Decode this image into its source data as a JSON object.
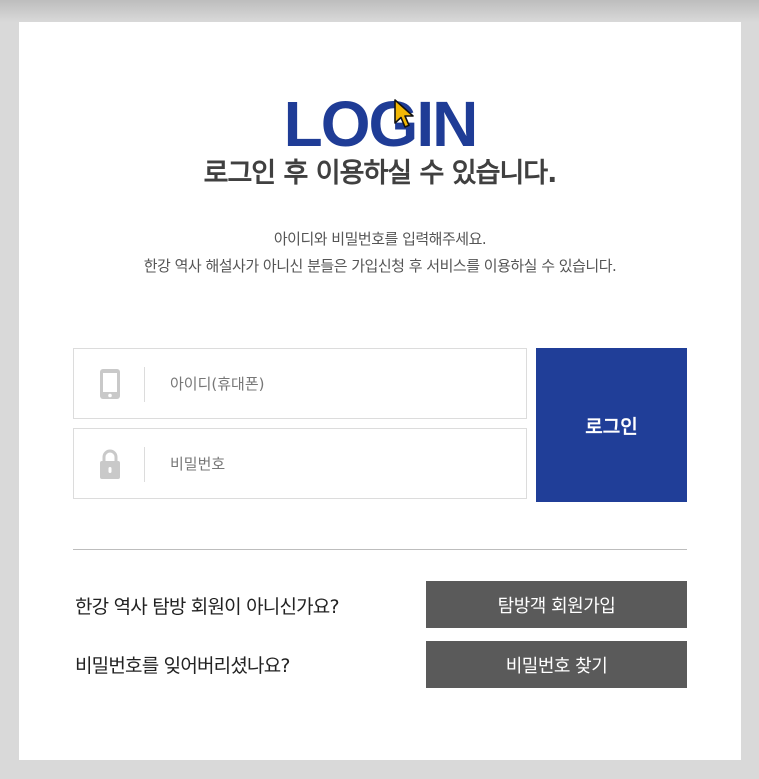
{
  "login": {
    "title": "LOGIN",
    "subtitle": "로그인 후 이용하실 수 있습니다.",
    "desc_line1": "아이디와 비밀번호를 입력해주세요.",
    "desc_line2": "한강 역사 해설사가 아니신 분들은 가입신청 후 서비스를 이용하실 수 있습니다.",
    "id_placeholder": "아이디(휴대폰)",
    "id_icon": "phone-icon",
    "pw_placeholder": "비밀번호",
    "pw_icon": "lock-icon",
    "login_button": "로그인"
  },
  "links": {
    "signup_question": "한강 역사 탐방 회원이 아니신가요?",
    "signup_button": "탐방객 회원가입",
    "find_pw_question": "비밀번호를 잊어버리셨나요?",
    "find_pw_button": "비밀번호 찾기"
  },
  "colors": {
    "brand": "#1f3c96",
    "button_gray": "#5a5a5a",
    "border": "#dcdcdc"
  }
}
